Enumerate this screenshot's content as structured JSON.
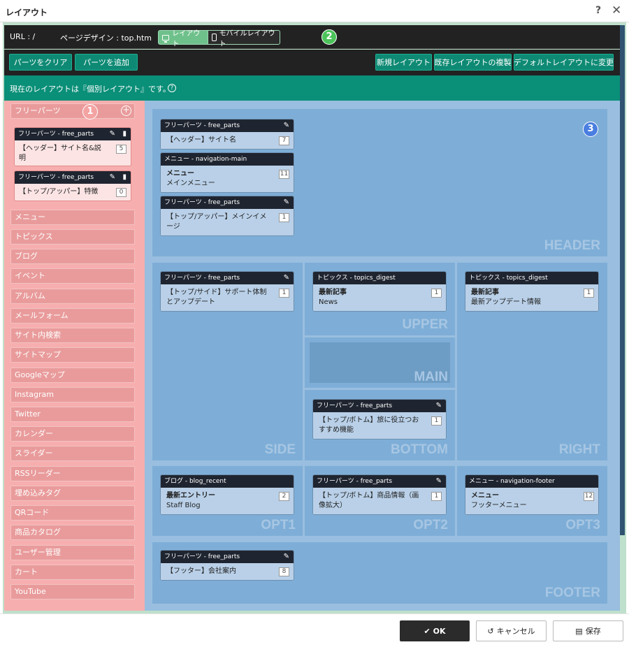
{
  "window": {
    "title": "レイアウト",
    "help": "?",
    "close": "✕"
  },
  "info": {
    "url": "URL : /",
    "design": "ページデザイン : top.htm",
    "layout_tab": "レイアウト",
    "mobile_tab": "モバイルレイアウト"
  },
  "markers": {
    "m1": "1",
    "m2": "2",
    "m3": "3"
  },
  "toolbar": {
    "clear": "パーツをクリア",
    "add": "パーツを追加",
    "new_layout": "新規レイアウト",
    "copy_layout": "既存レイアウトの複製",
    "default_layout": "デフォルトレイアウトに変更"
  },
  "status": {
    "text": "現在のレイアウトは『個別レイアウト』です。",
    "help": "?"
  },
  "left": {
    "free_parts": "フリーパーツ",
    "plus": "+",
    "cards": [
      {
        "head": "フリーパーツ - free_parts",
        "line1": "【ヘッダー】サイト名&説",
        "line2": "明",
        "count": "5"
      },
      {
        "head": "フリーパーツ - free_parts",
        "line1": "【トップ/アッパー】特徴",
        "line2": "",
        "count": "0"
      }
    ],
    "categories": [
      "メニュー",
      "トピックス",
      "ブログ",
      "イベント",
      "アルバム",
      "メールフォーム",
      "サイト内検索",
      "サイトマップ",
      "Googleマップ",
      "Instagram",
      "Twitter",
      "カレンダー",
      "スライダー",
      "RSSリーダー",
      "埋め込みタグ",
      "QRコード",
      "商品カタログ",
      "ユーザー管理",
      "カート",
      "YouTube"
    ]
  },
  "zones": {
    "header": {
      "label": "HEADER",
      "cards": [
        {
          "head": "フリーパーツ - free_parts",
          "line1": "【ヘッダー】サイト名",
          "line2": "",
          "count": "7"
        },
        {
          "head": "メニュー - navigation-main",
          "line1": "メニュー",
          "line2": "メインメニュー",
          "count": "11"
        },
        {
          "head": "フリーパーツ - free_parts",
          "line1": "【トップ/アッパー】メインイメ",
          "line2": "ージ",
          "count": "1"
        }
      ]
    },
    "side": {
      "label": "SIDE",
      "cards": [
        {
          "head": "フリーパーツ - free_parts",
          "line1": "【トップ/サイド】サポート体制",
          "line2": "とアップデート",
          "count": "1"
        }
      ]
    },
    "upper": {
      "label": "UPPER",
      "cards": [
        {
          "head": "トピックス - topics_digest",
          "line1": "最新記事",
          "line2": "News",
          "count": "1"
        }
      ]
    },
    "main": {
      "label": "MAIN"
    },
    "bottom": {
      "label": "BOTTOM",
      "cards": [
        {
          "head": "フリーパーツ - free_parts",
          "line1": "【トップ/ボトム】旅に役立つお",
          "line2": "すすめ機能",
          "count": "1"
        }
      ]
    },
    "right": {
      "label": "RIGHT",
      "cards": [
        {
          "head": "トピックス - topics_digest",
          "line1": "最新記事",
          "line2": "最新アップデート情報",
          "count": "1"
        }
      ]
    },
    "opt1": {
      "label": "OPT1",
      "cards": [
        {
          "head": "ブログ - blog_recent",
          "line1": "最新エントリー",
          "line2": "Staff Blog",
          "count": "2"
        }
      ]
    },
    "opt2": {
      "label": "OPT2",
      "cards": [
        {
          "head": "フリーパーツ - free_parts",
          "line1": "【トップ/ボトム】商品情報（画",
          "line2": "像拡大）",
          "count": "1"
        }
      ]
    },
    "opt3": {
      "label": "OPT3",
      "cards": [
        {
          "head": "メニュー - navigation-footer",
          "line1": "メニュー",
          "line2": "フッターメニュー",
          "count": "12"
        }
      ]
    },
    "footer": {
      "label": "FOOTER",
      "cards": [
        {
          "head": "フリーパーツ - free_parts",
          "line1": "【フッター】会社案内",
          "line2": "",
          "count": "8"
        }
      ]
    }
  },
  "buttons": {
    "ok": "OK",
    "cancel": "キャンセル",
    "save": "保存"
  },
  "colors": {
    "accent": "#0a8f78",
    "dark": "#222222",
    "left_bg": "#f7aeae",
    "right_bg": "#99bedf"
  }
}
